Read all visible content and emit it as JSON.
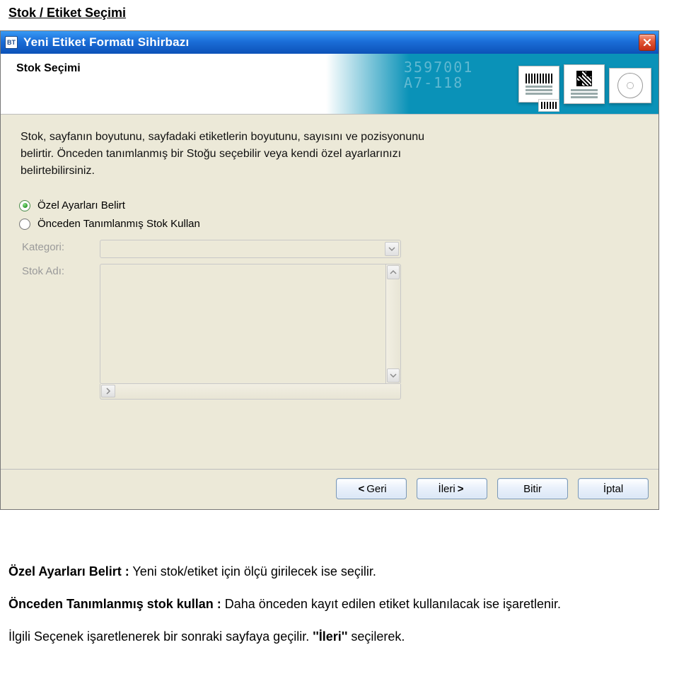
{
  "page": {
    "heading": "Stok / Etiket Seçimi"
  },
  "dialog": {
    "title": "Yeni Etiket Formatı Sihirbazı",
    "header_title": "Stok Seçimi",
    "header_ghost_a": "3597001",
    "header_ghost_b": "A7-118",
    "description": "Stok, sayfanın boyutunu, sayfadaki etiketlerin boyutunu, sayısını ve pozisyonunu belirtir. Önceden tanımlanmış bir Stoğu seçebilir veya kendi özel ayarlarınızı belirtebilirsiniz.",
    "radio_custom": "Özel Ayarları Belirt",
    "radio_predef": "Önceden Tanımlanmış Stok Kullan",
    "label_category": "Kategori:",
    "label_stockname": "Stok Adı:",
    "buttons": {
      "back": "Geri",
      "next": "İleri",
      "finish": "Bitir",
      "cancel": "İptal"
    }
  },
  "doc": {
    "p1_term": "Özel Ayarları Belirt :",
    "p1_rest": " Yeni stok/etiket için ölçü girilecek ise seçilir.",
    "p2_term": "Önceden Tanımlanmış stok kullan :",
    "p2_rest": " Daha önceden kayıt edilen etiket kullanılacak ise işaretlenir.",
    "p3_a": "İlgili Seçenek işaretlenerek bir sonraki sayfaya geçilir. ",
    "p3_bold": "''İleri''",
    "p3_b": " seçilerek."
  }
}
